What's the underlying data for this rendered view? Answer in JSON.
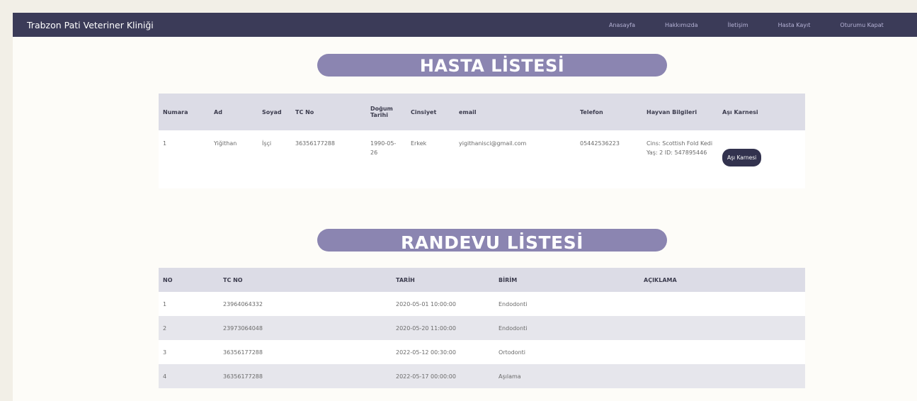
{
  "navbar": {
    "brand": "Trabzon Pati Veteriner Kliniği",
    "links": [
      "Anasayfa",
      "Hakkımızda",
      "İletişim",
      "Hasta Kayıt",
      "Oturumu Kapat"
    ]
  },
  "hasta": {
    "title": "HASTA LİSTESİ",
    "headers": [
      "Numara",
      "Ad",
      "Soyad",
      "TC No",
      "Doğum Tarihi",
      "Cinsiyet",
      "email",
      "Telefon",
      "Hayvan Bilgileri",
      "Aşı Karnesi"
    ],
    "rows": [
      {
        "numara": "1",
        "ad": "Yiğithan",
        "soyad": "İşçi",
        "tc": "36356177288",
        "dogum": "1990-05-26",
        "cinsiyet": "Erkek",
        "email": "yigithanisci@gmail.com",
        "telefon": "05442536223",
        "hayvan": "Cins: Scottish Fold Kedi Yaş: 2 ID: 547895446",
        "karne_button": "Aşı Karnesi"
      }
    ]
  },
  "randevu": {
    "title": "RANDEVU LİSTESİ",
    "headers": [
      "NO",
      "TC NO",
      "TARİH",
      "BİRİM",
      "AÇIKLAMA"
    ],
    "rows": [
      {
        "no": "1",
        "tc": "23964064332",
        "tarih": "2020-05-01 10:00:00",
        "birim": "Endodonti",
        "aciklama": ""
      },
      {
        "no": "2",
        "tc": "23973064048",
        "tarih": "2020-05-20 11:00:00",
        "birim": "Endodonti",
        "aciklama": ""
      },
      {
        "no": "3",
        "tc": "36356177288",
        "tarih": "2022-05-12 00:30:00",
        "birim": "Ortodonti",
        "aciklama": ""
      },
      {
        "no": "4",
        "tc": "36356177288",
        "tarih": "2022-05-17 00:00:00",
        "birim": "Aşılama",
        "aciklama": ""
      }
    ]
  }
}
